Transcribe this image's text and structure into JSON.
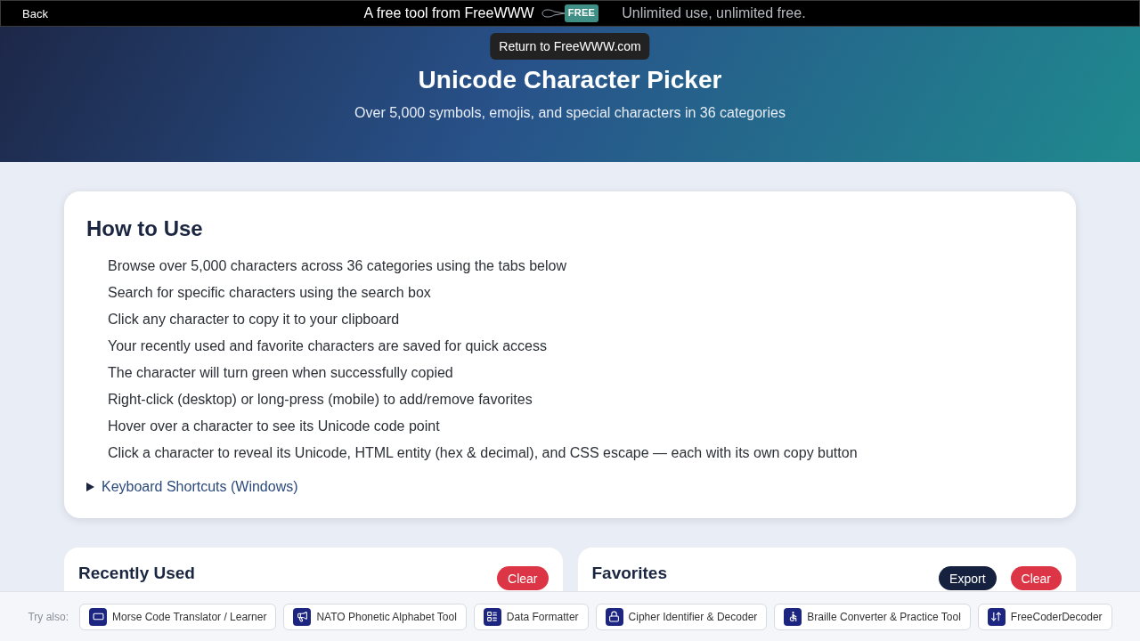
{
  "top_bar": {
    "back": "Back",
    "tagline": "A free tool from FreeWWW",
    "tag_logo": "FREE",
    "slogan": "Unlimited use, unlimited free.",
    "tooltip": "Return to FreeWWW.com"
  },
  "header": {
    "title": "Unicode Character Picker",
    "subtitle": "Over 5,000 symbols, emojis, and special characters in 36 categories"
  },
  "how_to_use": {
    "heading": "How to Use",
    "steps": [
      "Browse over 5,000 characters across 36 categories using the tabs below",
      "Search for specific characters using the search box",
      "Click any character to copy it to your clipboard",
      "Your recently used and favorite characters are saved for quick access",
      "The character will turn green when successfully copied",
      "Right-click (desktop) or long-press (mobile) to add/remove favorites",
      "Hover over a character to see its Unicode code point",
      "Click a character to reveal its Unicode, HTML entity (hex & decimal), and CSS escape — each with its own copy button"
    ],
    "shortcuts": {
      "label": "Keyboard Shortcuts (Windows)",
      "expanded": false
    }
  },
  "panels": [
    {
      "title": "Recently Used",
      "buttons": [
        {
          "label": "Clear",
          "kind": "danger"
        }
      ]
    },
    {
      "title": "Favorites",
      "buttons": [
        {
          "label": "Export",
          "kind": "dark"
        },
        {
          "label": "Clear",
          "kind": "danger"
        }
      ]
    }
  ],
  "try_also": {
    "label": "Try also:",
    "tools": [
      "Morse Code Translator / Learner",
      "NATO Phonetic Alphabet Tool",
      "Data Formatter",
      "Cipher Identifier & Decoder",
      "Braille Converter & Practice Tool",
      "FreeCoderDecoder"
    ]
  }
}
